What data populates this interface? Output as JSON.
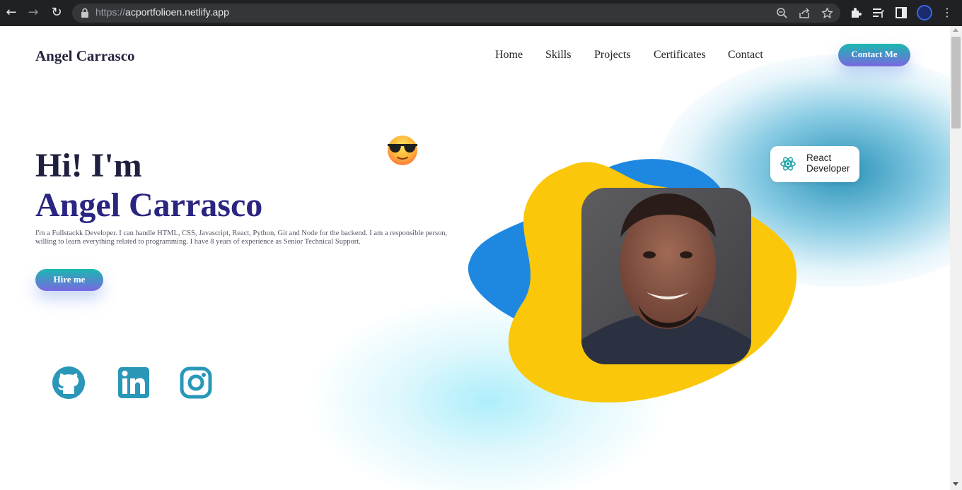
{
  "browser": {
    "url_scheme": "https://",
    "url_host": "acportfolioen.netlify.app",
    "back_glyph": "←",
    "forward_glyph": "→",
    "reload_glyph": "↻",
    "menu_glyph": "⋮"
  },
  "header": {
    "brand": "Angel Carrasco",
    "nav": [
      "Home",
      "Skills",
      "Projects",
      "Certificates",
      "Contact"
    ],
    "contact_button": "Contact Me"
  },
  "hero": {
    "greeting": "Hi! I'm",
    "name": "Angel Carrasco",
    "description": "I'm a Fullstackk Developer. I can handle HTML, CSS, Javascript, React, Python, Git and Node for the backend. I am a responsible person, willing to learn everything related to programming. I have 8 years of experience as Senior Technical Support.",
    "hire_button": "Hire me",
    "emoji_icon": "sunglasses-emoji-icon"
  },
  "badge": {
    "icon": "react-icon",
    "line1": "React",
    "line2": "Developer"
  },
  "social": [
    "github-icon",
    "linkedin-icon",
    "instagram-icon"
  ],
  "colors": {
    "accent_start": "#1ab8b0",
    "accent_end": "#7a67e0",
    "name_color": "#2a2580",
    "blob_yellow": "#fbc70a",
    "blob_blue": "#1e88e0",
    "social_color": "#2a97b8"
  }
}
